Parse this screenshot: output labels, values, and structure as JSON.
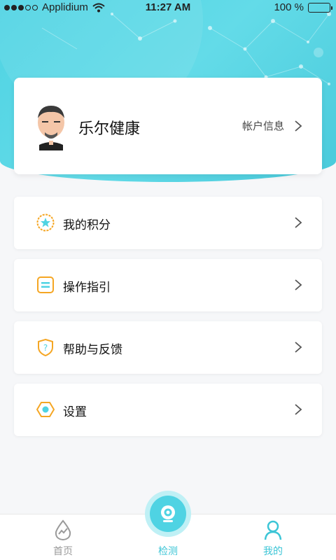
{
  "status_bar": {
    "carrier": "Applidium",
    "time": "11:27 AM",
    "battery": "100 %",
    "battery_level": 1.0
  },
  "profile": {
    "name": "乐尔健康",
    "account_link": "帐户信息"
  },
  "menu": [
    {
      "label": "我的积分",
      "icon": "star-badge-icon"
    },
    {
      "label": "操作指引",
      "icon": "guide-list-icon"
    },
    {
      "label": "帮助与反馈",
      "icon": "help-shield-icon"
    },
    {
      "label": "设置",
      "icon": "settings-hexagon-icon"
    }
  ],
  "tabbar": {
    "home": {
      "label": "首页",
      "icon": "drop-chart-icon",
      "color": "#9a9a9a"
    },
    "detect": {
      "label": "检测",
      "icon": "camera-icon",
      "color": "#3cc5d6"
    },
    "mine": {
      "label": "我的",
      "icon": "person-icon",
      "color": "#3cc5d6"
    }
  },
  "colors": {
    "accent": "#4fd3e3",
    "icon_orange": "#f5a623"
  }
}
